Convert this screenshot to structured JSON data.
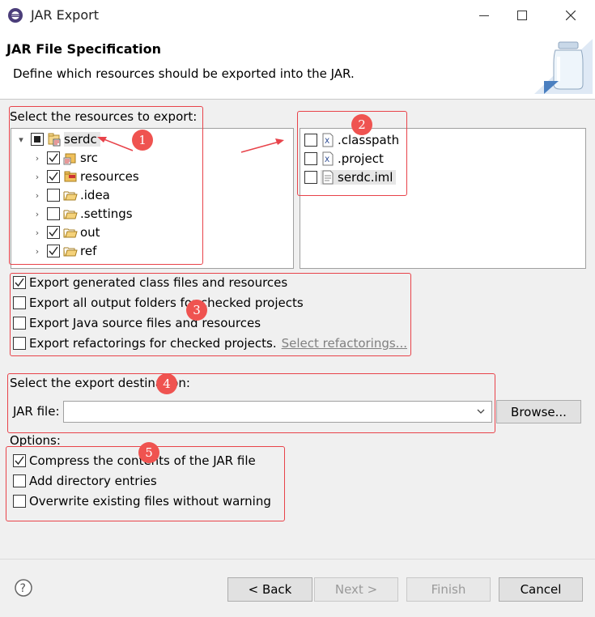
{
  "window": {
    "title": "JAR Export"
  },
  "header": {
    "title": "JAR File Specification",
    "description": "Define which resources should be exported into the JAR."
  },
  "resources": {
    "label": "Select the resources to export:",
    "tree": [
      {
        "label": "serdc",
        "state": "partial",
        "expanded": true,
        "icon": "project-icon"
      },
      {
        "label": "src",
        "state": "checked",
        "icon": "source-folder-icon"
      },
      {
        "label": "resources",
        "state": "checked",
        "icon": "resource-folder-icon"
      },
      {
        "label": ".idea",
        "state": "unchecked",
        "icon": "folder-icon"
      },
      {
        "label": ".settings",
        "state": "unchecked",
        "icon": "folder-icon"
      },
      {
        "label": "out",
        "state": "checked",
        "icon": "folder-icon"
      },
      {
        "label": "ref",
        "state": "checked",
        "icon": "folder-icon"
      }
    ],
    "files": [
      {
        "label": ".classpath",
        "state": "unchecked",
        "icon": "xml-file-icon"
      },
      {
        "label": ".project",
        "state": "unchecked",
        "icon": "xml-file-icon"
      },
      {
        "label": "serdc.iml",
        "state": "unchecked",
        "icon": "text-file-icon"
      }
    ]
  },
  "export_options": {
    "generated": "Export generated class files and resources",
    "output_folders": "Export all output folders for checked projects",
    "java_source": "Export Java source files and resources",
    "refactorings": "Export refactorings for checked projects.",
    "select_refactorings": "Select refactorings..."
  },
  "destination": {
    "label": "Select the export destination:",
    "jar_label": "JAR file:",
    "jar_value": "",
    "browse": "Browse..."
  },
  "options": {
    "label": "Options:",
    "compress": "Compress the contents of the JAR file",
    "directory_entries": "Add directory entries",
    "overwrite": "Overwrite existing files without warning"
  },
  "buttons": {
    "back": "< Back",
    "next": "Next >",
    "finish": "Finish",
    "cancel": "Cancel"
  },
  "annotations": [
    "1",
    "2",
    "3",
    "4",
    "5"
  ],
  "colors": {
    "annotation": "#ef5350",
    "window_bg": "#f0f0f0"
  }
}
